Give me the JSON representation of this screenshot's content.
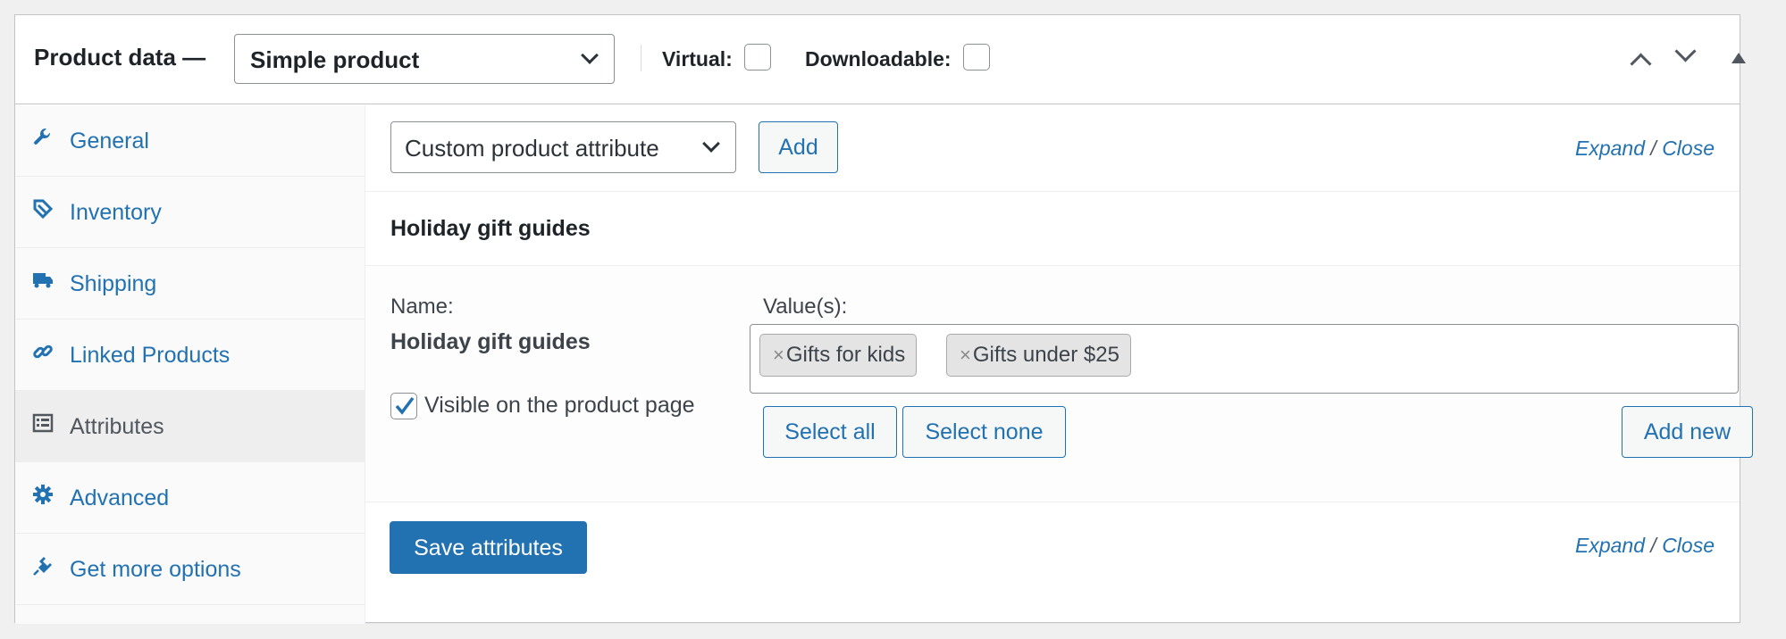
{
  "header": {
    "title": "Product data —",
    "product_type": "Simple product",
    "virtual_label": "Virtual:",
    "downloadable_label": "Downloadable:",
    "virtual_checked": false,
    "downloadable_checked": false
  },
  "sidebar": {
    "items": [
      {
        "label": "General",
        "icon": "wrench-icon",
        "active": false
      },
      {
        "label": "Inventory",
        "icon": "tag-icon",
        "active": false
      },
      {
        "label": "Shipping",
        "icon": "truck-icon",
        "active": false
      },
      {
        "label": "Linked Products",
        "icon": "link-icon",
        "active": false
      },
      {
        "label": "Attributes",
        "icon": "list-view-icon",
        "active": true
      },
      {
        "label": "Advanced",
        "icon": "gear-icon",
        "active": false
      },
      {
        "label": "Get more options",
        "icon": "plugin-icon",
        "active": false
      }
    ]
  },
  "toolbar": {
    "attribute_select": "Custom product attribute",
    "add_label": "Add",
    "expand_label": "Expand",
    "divider": "/",
    "close_label": "Close"
  },
  "attribute": {
    "heading": "Holiday gift guides",
    "name_label": "Name:",
    "name_value": "Holiday gift guides",
    "visible_label": "Visible on the product page",
    "visible_checked": true,
    "values_label": "Value(s):",
    "chip_remove": "×",
    "values": [
      "Gifts for kids",
      "Gifts under $25"
    ],
    "select_all_label": "Select all",
    "select_none_label": "Select none",
    "add_new_label": "Add new"
  },
  "footer": {
    "save_label": "Save attributes",
    "expand_label": "Expand",
    "divider": "/",
    "close_label": "Close"
  },
  "colors": {
    "accent": "#2271b1",
    "text": "#1d2327",
    "border": "#8c8f94"
  }
}
